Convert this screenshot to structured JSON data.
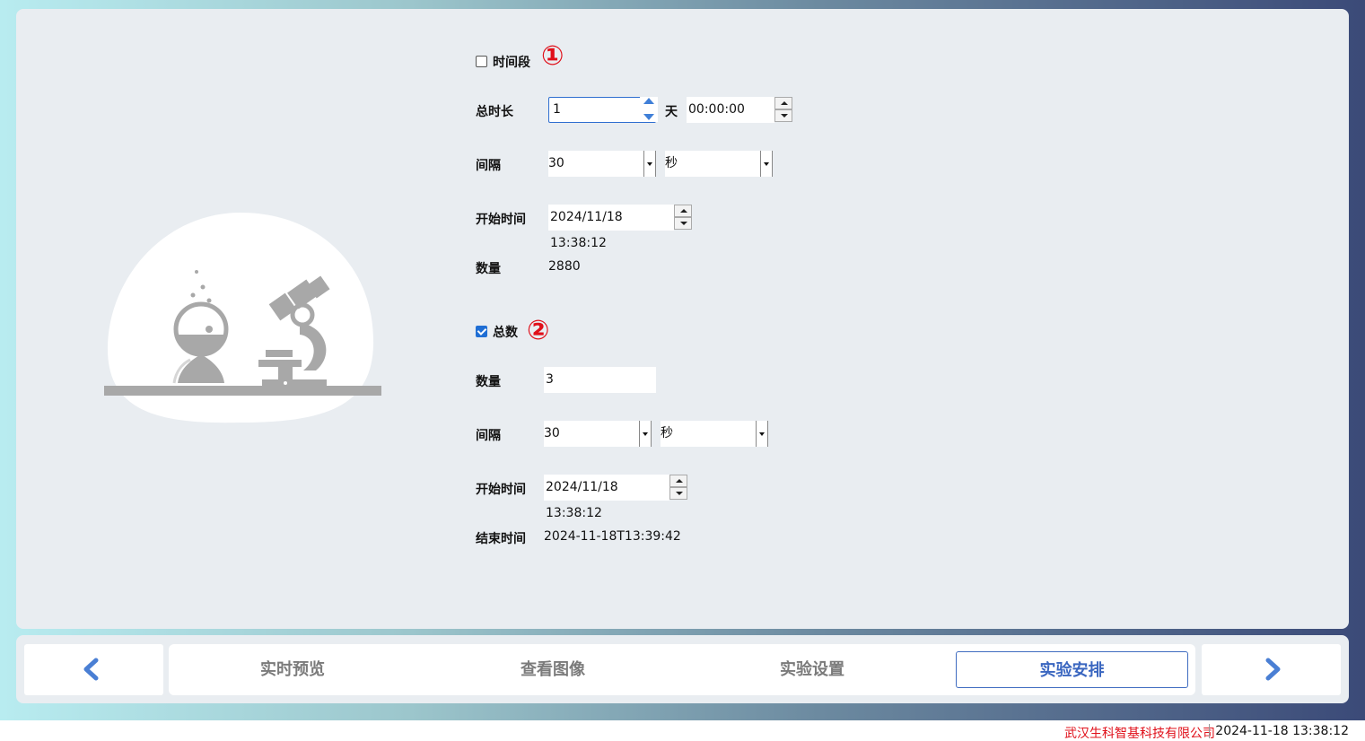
{
  "section_period": {
    "checkbox_label": "时间段",
    "checked": false,
    "badge": "①",
    "total_duration": {
      "label": "总时长",
      "days_value": "1",
      "days_unit": "天",
      "time_value": "00:00:00"
    },
    "interval": {
      "label": "间隔",
      "value": "30",
      "unit": "秒"
    },
    "start_time": {
      "label": "开始时间",
      "value": "2024/11/18 13:38:12"
    },
    "count": {
      "label": "数量",
      "value": "2880"
    }
  },
  "section_total": {
    "checkbox_label": "总数",
    "checked": true,
    "badge": "②",
    "count": {
      "label": "数量",
      "value": "3"
    },
    "interval": {
      "label": "间隔",
      "value": "30",
      "unit": "秒"
    },
    "start_time": {
      "label": "开始时间",
      "value": "2024/11/18 13:38:12"
    },
    "end_time": {
      "label": "结束时间",
      "value": "2024-11-18T13:39:42"
    }
  },
  "nav": {
    "prev_icon": "chevron-left-icon",
    "next_icon": "chevron-right-icon",
    "tabs": [
      {
        "label": "实时预览",
        "active": false
      },
      {
        "label": "查看图像",
        "active": false
      },
      {
        "label": "实验设置",
        "active": false
      },
      {
        "label": "实验安排",
        "active": true
      }
    ]
  },
  "status": {
    "company": "武汉生科智基科技有限公司",
    "datetime": "2024-11-18 13:38:12"
  },
  "colors": {
    "accent": "#3f6cc0",
    "badge": "#e0101a",
    "illustration": "#a8a8a8"
  }
}
